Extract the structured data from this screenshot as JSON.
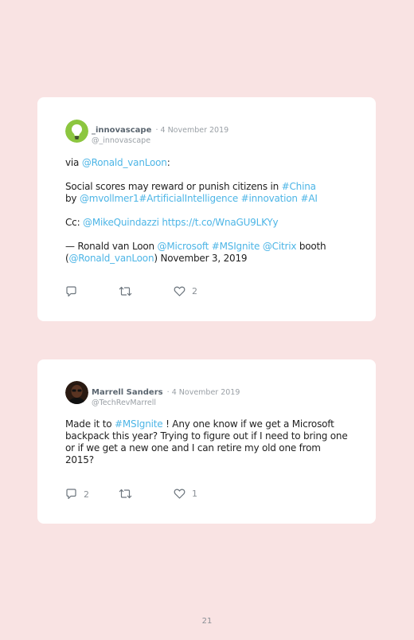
{
  "tweets": [
    {
      "name": "_innovascape",
      "date": "· 4 November 2019",
      "handle": "@_innovascape",
      "line1_pre": "via ",
      "line1_link": "@Ronald_vanLoon",
      "line1_post": ":",
      "para2_pre": "Social scores may reward or punish citizens in ",
      "para2_link1": "#China",
      "para2_mid": "by ",
      "para2_link2": "@mvollmer1",
      "para2_link3": "#ArtificialIntelligence",
      "para2_link4": "#innovation",
      "para2_link5": "#AI",
      "para3_pre": "Cc: ",
      "para3_link1": "@MikeQuindazzi",
      "para3_link2": "https://t.co/WnaGU9LKYy",
      "para4_pre": "— Ronald van Loon ",
      "para4_link1": "@Microsoft",
      "para4_link2": "#MSIgnite",
      "para4_link3": "@Citrix",
      "para4_mid": " booth",
      "para4_open": "(",
      "para4_link4": "@Ronald_vanLoon",
      "para4_post": ") November 3, 2019",
      "likes": "2",
      "replies": "",
      "retweets": ""
    },
    {
      "name": "Marrell Sanders",
      "date": "· 4 November 2019",
      "handle": "@TechRevMarrell",
      "text_pre": "Made it to ",
      "text_link": "#MSIgnite",
      "text_post": " ! Any one know if we get a Microsoft backpack this year? Trying to figure out if I need to bring one or if we get a new one and I can retire my old one from 2015?",
      "replies": "2",
      "retweets": "",
      "likes": "1"
    }
  ],
  "page_number": "21",
  "icons": {
    "reply": "reply-icon",
    "retweet": "retweet-icon",
    "like": "heart-icon",
    "avatar1": "lightbulb-avatar-icon",
    "avatar2": "user-avatar"
  },
  "colors": {
    "background": "#f9e3e3",
    "link": "#4db5e6",
    "avatar1_bg": "#8cc63f"
  }
}
